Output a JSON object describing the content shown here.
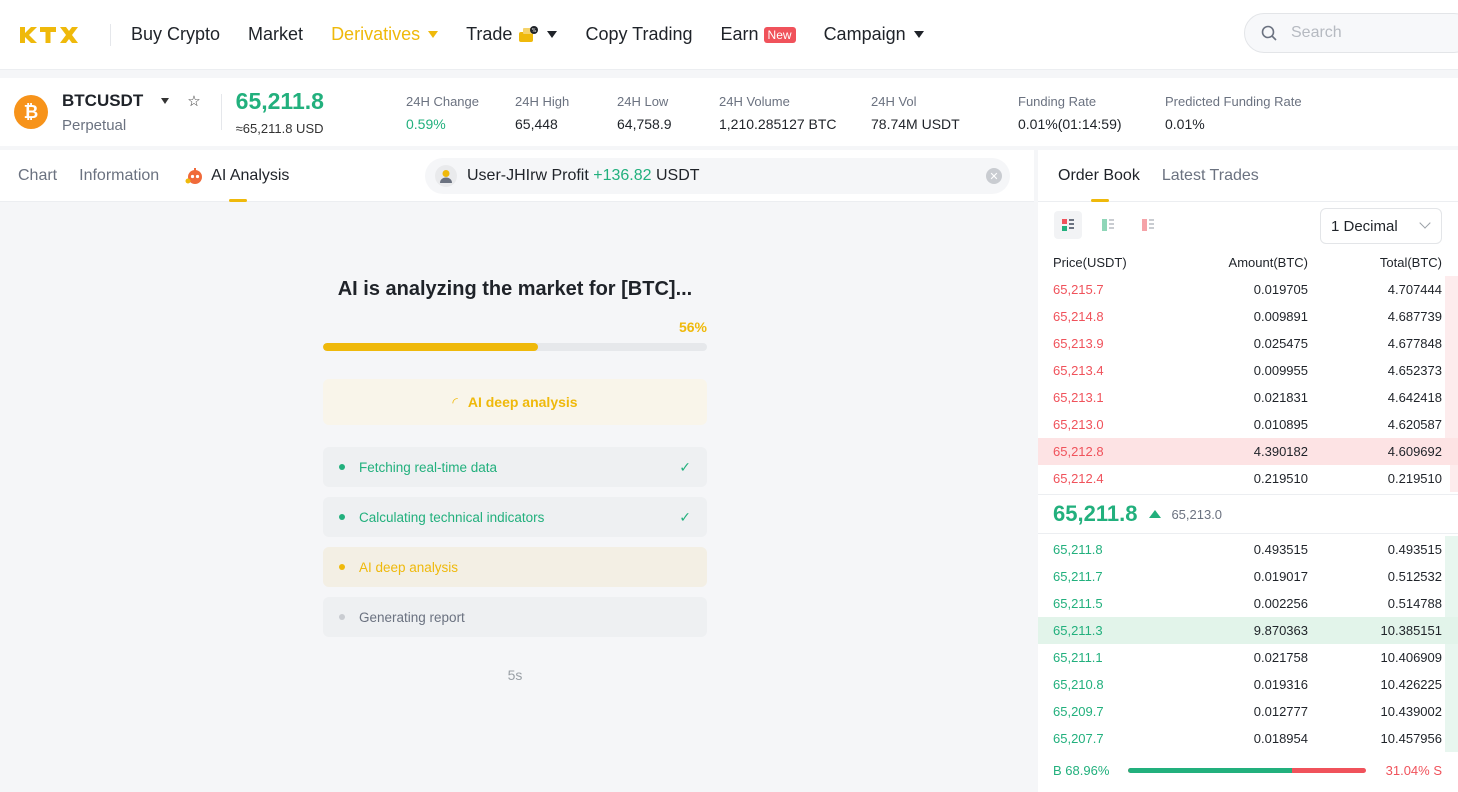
{
  "nav": {
    "logo_text": "KTX",
    "items": [
      "Buy Crypto",
      "Market",
      "Derivatives",
      "Trade",
      "Copy Trading",
      "Earn",
      "Campaign"
    ],
    "earn_badge": "New",
    "search_placeholder": "Search"
  },
  "ticker": {
    "symbol": "BTCUSDT",
    "type": "Perpetual",
    "price": "65,211.8",
    "price_usd": "≈65,211.8 USD",
    "stats": [
      {
        "label": "24H Change",
        "value": "0.59%"
      },
      {
        "label": "24H High",
        "value": "65,448"
      },
      {
        "label": "24H Low",
        "value": "64,758.9"
      },
      {
        "label": "24H Volume",
        "value": "1,210.285127 BTC"
      },
      {
        "label": "24H Vol",
        "value": "78.74M USDT"
      },
      {
        "label": "Funding Rate",
        "value": "0.01%(01:14:59)"
      },
      {
        "label": "Predicted Funding Rate",
        "value": "0.01%"
      }
    ]
  },
  "left_tabs": [
    "Chart",
    "Information",
    "AI Analysis"
  ],
  "profit": {
    "user": "User-JHIrw",
    "label": "Profit",
    "amount": "+136.82",
    "unit": "USDT"
  },
  "analysis": {
    "title": "AI is analyzing the market for [BTC]...",
    "progress_text": "56%",
    "progress": 0.56,
    "status": "AI deep analysis",
    "steps": [
      {
        "label": "Fetching real-time data",
        "state": "done"
      },
      {
        "label": "Calculating technical indicators",
        "state": "done"
      },
      {
        "label": "AI deep analysis",
        "state": "current"
      },
      {
        "label": "Generating report",
        "state": "pending"
      }
    ],
    "timer": "5s"
  },
  "right_tabs": [
    "Order Book",
    "Latest Trades"
  ],
  "decimal": "1 Decimal",
  "orderbook": {
    "headers": [
      "Price(USDT)",
      "Amount(BTC)",
      "Total(BTC)"
    ],
    "asks": [
      {
        "price": "65,215.7",
        "amount": "0.019705",
        "total": "4.707444",
        "depth": 0.03
      },
      {
        "price": "65,214.8",
        "amount": "0.009891",
        "total": "4.687739",
        "depth": 0.03
      },
      {
        "price": "65,213.9",
        "amount": "0.025475",
        "total": "4.677848",
        "depth": 0.03
      },
      {
        "price": "65,213.4",
        "amount": "0.009955",
        "total": "4.652373",
        "depth": 0.03
      },
      {
        "price": "65,213.1",
        "amount": "0.021831",
        "total": "4.642418",
        "depth": 0.03
      },
      {
        "price": "65,213.0",
        "amount": "0.010895",
        "total": "4.620587",
        "depth": 0.03
      },
      {
        "price": "65,212.8",
        "amount": "4.390182",
        "total": "4.609692",
        "depth": 1.0
      },
      {
        "price": "65,212.4",
        "amount": "0.219510",
        "total": "0.219510",
        "depth": 0.02
      }
    ],
    "mid_price": "65,211.8",
    "mark_price": "65,213.0",
    "bids": [
      {
        "price": "65,211.8",
        "amount": "0.493515",
        "total": "0.493515",
        "depth": 0.03
      },
      {
        "price": "65,211.7",
        "amount": "0.019017",
        "total": "0.512532",
        "depth": 0.03
      },
      {
        "price": "65,211.5",
        "amount": "0.002256",
        "total": "0.514788",
        "depth": 0.03
      },
      {
        "price": "65,211.3",
        "amount": "9.870363",
        "total": "10.385151",
        "depth": 1.0
      },
      {
        "price": "65,211.1",
        "amount": "0.021758",
        "total": "10.406909",
        "depth": 0.03
      },
      {
        "price": "65,210.8",
        "amount": "0.019316",
        "total": "10.426225",
        "depth": 0.03
      },
      {
        "price": "65,209.7",
        "amount": "0.012777",
        "total": "10.439002",
        "depth": 0.03
      },
      {
        "price": "65,207.7",
        "amount": "0.018954",
        "total": "10.457956",
        "depth": 0.03
      }
    ],
    "buy_ratio": "B 68.96%",
    "sell_ratio": "31.04% S",
    "buy_fraction": 0.6896
  },
  "colors": {
    "accent": "#efb90b",
    "up": "#22b07d",
    "down": "#f0525b"
  }
}
